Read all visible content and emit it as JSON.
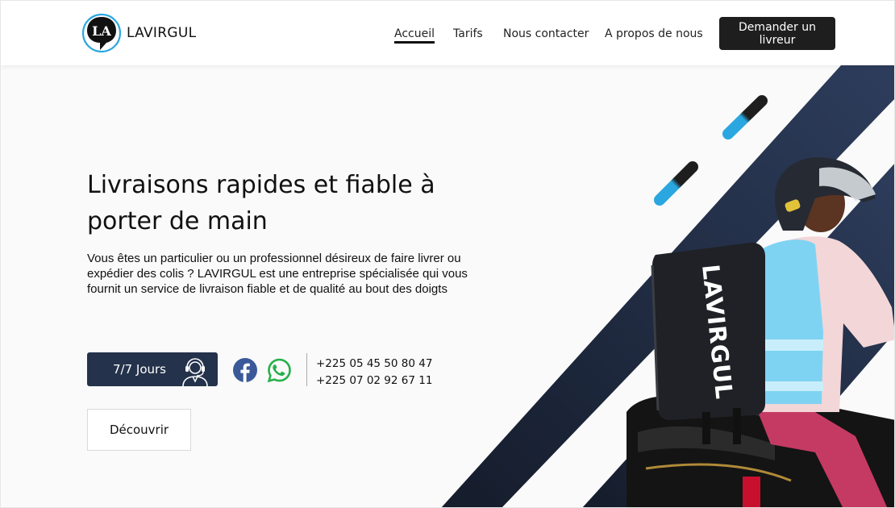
{
  "brand": {
    "name": "LAVIRGUL",
    "logo_icon": "la-monogram-speech-bubble-icon",
    "logo_letters": "LA"
  },
  "nav": {
    "items": [
      {
        "label": "Accueil",
        "active": true
      },
      {
        "label": "Tarifs",
        "active": false
      },
      {
        "label": "Nous contacter",
        "active": false
      },
      {
        "label": "A propos de nous",
        "active": false
      }
    ],
    "cta_label": "Demander un livreur"
  },
  "hero": {
    "title": "Livraisons rapides et fiable à porter de main",
    "description": "Vous êtes un particulier ou un professionnel désireux de faire livrer ou expédier des colis ? LAVIRGUL est une entreprise spécialisée qui vous fournit un service de livraison fiable et de qualité au bout des doigts",
    "availability_label": "7/7 Jours",
    "availability_icon": "support-agent-icon",
    "social": [
      {
        "icon": "facebook-icon",
        "color": "#3b5998"
      },
      {
        "icon": "whatsapp-icon",
        "color": "#25d366"
      }
    ],
    "phones": [
      "+225 05 45 50 80 47",
      "+225 07 02 92 67 11"
    ],
    "discover_label": "Découvrir",
    "bag_text": "LAVIRGUL",
    "image": "delivery-rider-on-motorbike"
  },
  "colors": {
    "navy": "#24324b",
    "dark_stripe": "#1b2538",
    "accent_blue": "#2aa7e0",
    "cta_bg": "#1e1e1e"
  }
}
